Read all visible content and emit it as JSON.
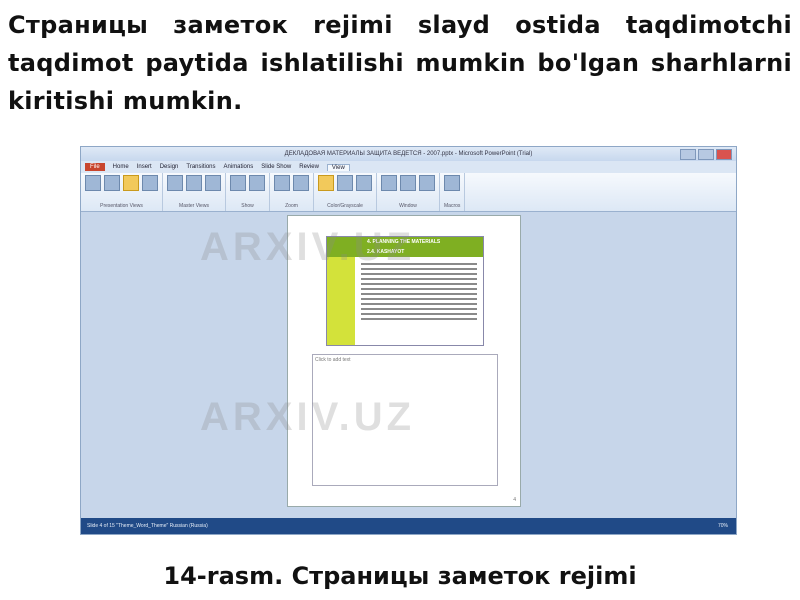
{
  "paragraph": "Страницы заметок rejimi slayd ostida taqdimotchi taqdimot paytida ishlatilishi mumkin bo'lgan sharhlarni kiritishi mumkin.",
  "caption": "14-rasm. Страницы заметок rejimi",
  "watermark": "ARXIV.UZ",
  "screenshot": {
    "window_title": "ДЕКЛАДОВАЯ МАТЕРИАЛЫ ЗАЩИТА ВЕДЕТСЯ - 2007.pptx - Microsoft PowerPoint (Trial)",
    "tabs": [
      "File",
      "Home",
      "Insert",
      "Design",
      "Transitions",
      "Animations",
      "Slide Show",
      "Review",
      "View"
    ],
    "active_tab": "View",
    "ribbon_groups": [
      "Presentation Views",
      "Master Views",
      "Show",
      "Zoom",
      "Color/Grayscale",
      "Window",
      "Macros"
    ],
    "slide_title": "4. PLANNING THE MATERIALS",
    "slide_subtitle": "2.4. KASHAYOT",
    "notes_placeholder": "Click to add text",
    "page_number": "4",
    "status_left": "Slide 4 of 15   \"Theme_Word_Theme\"   Russian (Russia)",
    "status_right": "70%"
  },
  "colors": {
    "slide_header": "#7faf22",
    "slide_side": "#d3e23a",
    "taskbar": "#204a87"
  }
}
